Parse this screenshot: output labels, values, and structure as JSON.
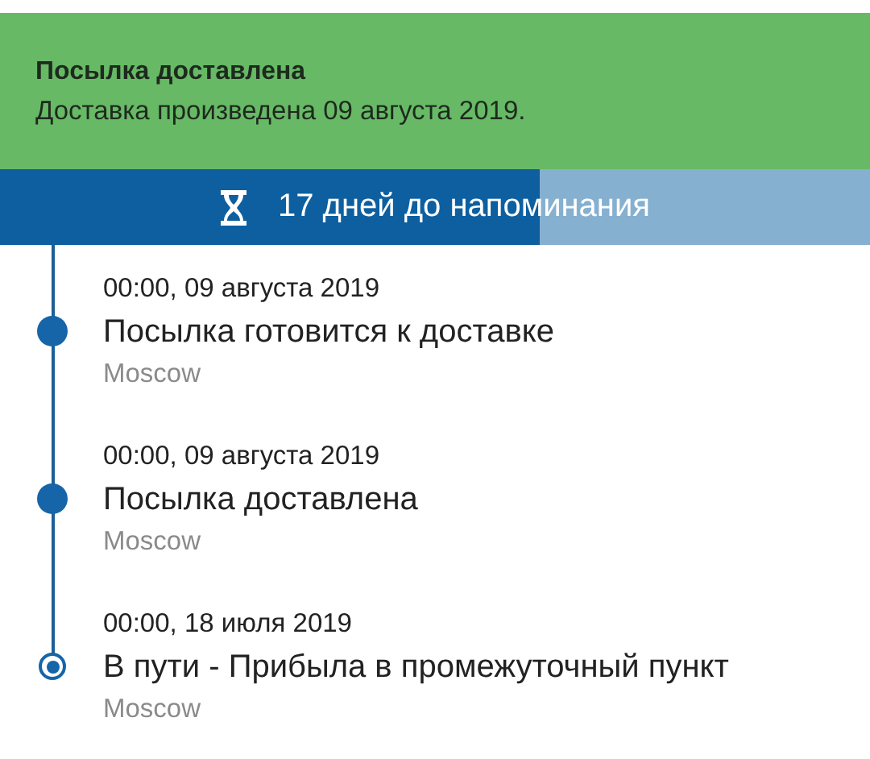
{
  "banner": {
    "title": "Посылка доставлена",
    "text": "Доставка произведена 09 августа 2019."
  },
  "reminder": {
    "label": "17 дней до напоминания",
    "level": 0.62
  },
  "events": [
    {
      "kind": "dot",
      "time": "00:00, 09 августа 2019",
      "status": "Посылка готовится к доставке",
      "place": "Moscow"
    },
    {
      "kind": "dot",
      "time": "00:00, 09 августа 2019",
      "status": "Посылка доставлена",
      "place": "Moscow"
    },
    {
      "kind": "ring",
      "time": "00:00, 18 июля 2019",
      "status": "В пути - Прибыла в промежуточный пункт",
      "place": "Moscow"
    }
  ]
}
